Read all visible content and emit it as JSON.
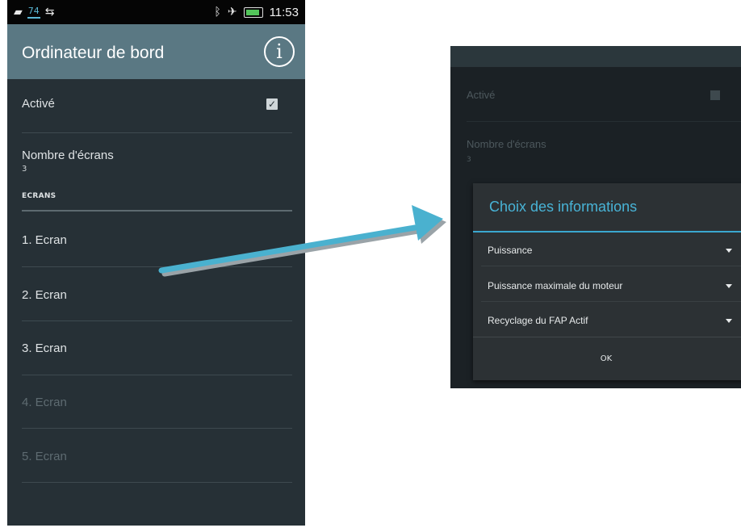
{
  "status_bar": {
    "badge": "74",
    "time": "11:53"
  },
  "left_screen": {
    "title": "Ordinateur de bord",
    "enabled_label": "Activé",
    "enabled_checked": true,
    "screens_count_label": "Nombre d'écrans",
    "screens_count_value": "3",
    "section_header": "ECRANS",
    "screen_items": [
      {
        "label": "1. Ecran",
        "enabled": true
      },
      {
        "label": "2. Ecran",
        "enabled": true
      },
      {
        "label": "3. Ecran",
        "enabled": true
      },
      {
        "label": "4. Ecran",
        "enabled": false
      },
      {
        "label": "5. Ecran",
        "enabled": false
      }
    ]
  },
  "right_screen": {
    "enabled_label": "Activé",
    "screens_count_label": "Nombre d'écrans",
    "screens_count_value": "3",
    "dialog": {
      "title": "Choix des informations",
      "items": [
        "Puissance",
        "Puissance maximale du moteur",
        "Recyclage du FAP Actif"
      ],
      "ok_label": "OK"
    }
  },
  "colors": {
    "accent": "#3aa7cf",
    "action_bar": "#5a7883",
    "background": "#263036",
    "arrow": "#4ab1cf"
  }
}
